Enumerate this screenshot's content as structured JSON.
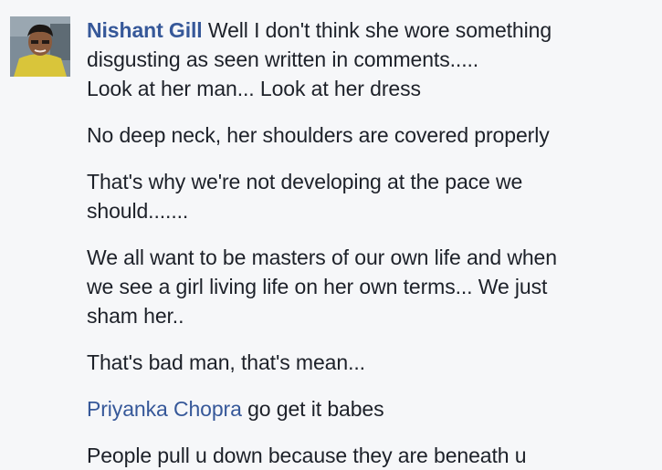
{
  "comment": {
    "author": "Nishant Gill",
    "avatar_icon": "user-photo",
    "colors": {
      "author": "#365899",
      "text": "#1d2129",
      "background": "#f6f7f9"
    },
    "intro_lines": [
      " Well I don't think she wore something",
      "disgusting as seen written in comments.....",
      "Look at her man... Look at her dress"
    ],
    "paragraphs": [
      {
        "lines": [
          "No deep neck, her shoulders are covered properly"
        ]
      },
      {
        "lines": [
          "That's why we're not developing at the pace we",
          "should......."
        ]
      },
      {
        "lines": [
          "We all want to be masters of our own life and when",
          "we see a girl living life on her own terms... We just",
          "sham her.."
        ]
      },
      {
        "lines": [
          "That's bad man, that's mean..."
        ]
      }
    ],
    "mention": {
      "name": "Priyanka Chopra",
      "text": " go get it babes"
    },
    "last_line": "People pull u down because they are beneath u"
  }
}
